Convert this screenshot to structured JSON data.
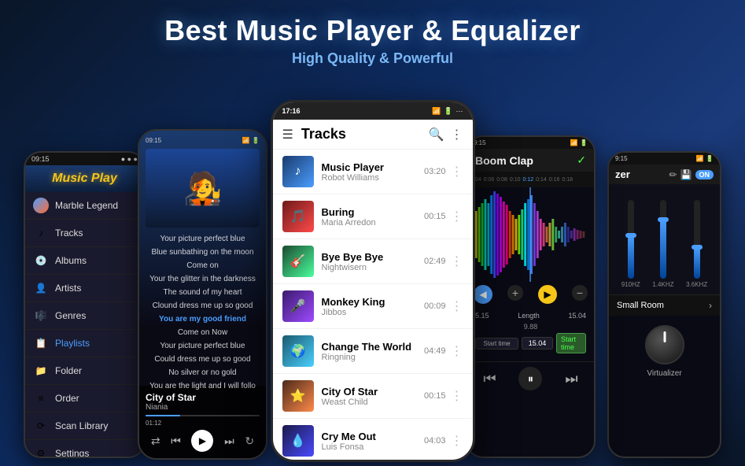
{
  "header": {
    "title": "Best Music Player & Equalizer",
    "subtitle": "High Quality & Powerful"
  },
  "left_phone": {
    "status_time": "09:15",
    "app_title": "Music Play",
    "menu_items": [
      {
        "id": "marble",
        "label": "Marble Legend",
        "icon": "🎵",
        "type": "avatar"
      },
      {
        "id": "tracks",
        "label": "Tracks",
        "icon": "♪",
        "active": false
      },
      {
        "id": "albums",
        "label": "Albums",
        "icon": "💿",
        "active": false
      },
      {
        "id": "artists",
        "label": "Artists",
        "icon": "👤",
        "active": false
      },
      {
        "id": "genres",
        "label": "Genres",
        "icon": "🎼",
        "active": false
      },
      {
        "id": "playlists",
        "label": "Playlists",
        "icon": "📋",
        "active": false
      },
      {
        "id": "folder",
        "label": "Folder",
        "icon": "📁",
        "active": false
      },
      {
        "id": "order",
        "label": "Order",
        "icon": "≡",
        "active": false
      },
      {
        "id": "scan",
        "label": "Scan Library",
        "icon": "⟳",
        "active": false
      },
      {
        "id": "settings",
        "label": "Settings",
        "icon": "⚙",
        "active": false
      }
    ]
  },
  "lyrics_phone": {
    "lines": [
      "Your picture perfect blue",
      "Blue sunbathing on the moon",
      "Come on",
      "Your the glitter in the darkness",
      "The sound of my heart",
      "Clound dress me up so good",
      "You are my good friend",
      "Come on  Now",
      "Your picture perfect blue",
      "Could dress me up so good",
      "No silver or no gold",
      "You are the light and I will follo"
    ],
    "highlight_line": "You are my good friend",
    "song": "City of Star",
    "artist": "Niania",
    "time": "01:12"
  },
  "center_phone": {
    "status_time": "17:16",
    "header_title": "Tracks",
    "tracks": [
      {
        "id": 1,
        "name": "Music Player",
        "artist": "Robot Williams",
        "duration": "03:20",
        "color": "thumb-1"
      },
      {
        "id": 2,
        "name": "Buring",
        "artist": "Maria Arredon",
        "duration": "00:15",
        "color": "thumb-2"
      },
      {
        "id": 3,
        "name": "Bye Bye Bye",
        "artist": "Nightwisern",
        "duration": "02:49",
        "color": "thumb-3"
      },
      {
        "id": 4,
        "name": "Monkey King",
        "artist": "Jibbos",
        "duration": "00:09",
        "color": "thumb-4"
      },
      {
        "id": 5,
        "name": "Change The World",
        "artist": "Ringning",
        "duration": "04:49",
        "color": "thumb-5"
      },
      {
        "id": 6,
        "name": "City Of Star",
        "artist": "Weast Child",
        "duration": "00:15",
        "color": "thumb-6"
      },
      {
        "id": 7,
        "name": "Cry Me Out",
        "artist": "Luis Fonsa",
        "duration": "04:03",
        "color": "thumb-7"
      }
    ]
  },
  "waveform_phone": {
    "song_name": "Boom Clap",
    "timeline_marks": [
      "0:04",
      "0:06",
      "0:08",
      "0:10",
      "0:12",
      "0:14",
      "0:16",
      "0:18"
    ],
    "time_start": "5.15",
    "time_length": "9.88",
    "time_end": "15.04",
    "start_time_label": "Start time"
  },
  "eq_phone": {
    "title": "zer",
    "on_label": "ON",
    "sliders": [
      {
        "freq": "910HZ",
        "height_pct": 55
      },
      {
        "freq": "1.4KHZ",
        "height_pct": 75
      },
      {
        "freq": "3.6KHZ",
        "height_pct": 40
      }
    ],
    "preset": "Small Room",
    "virtualizer_label": "Virtualizer"
  }
}
